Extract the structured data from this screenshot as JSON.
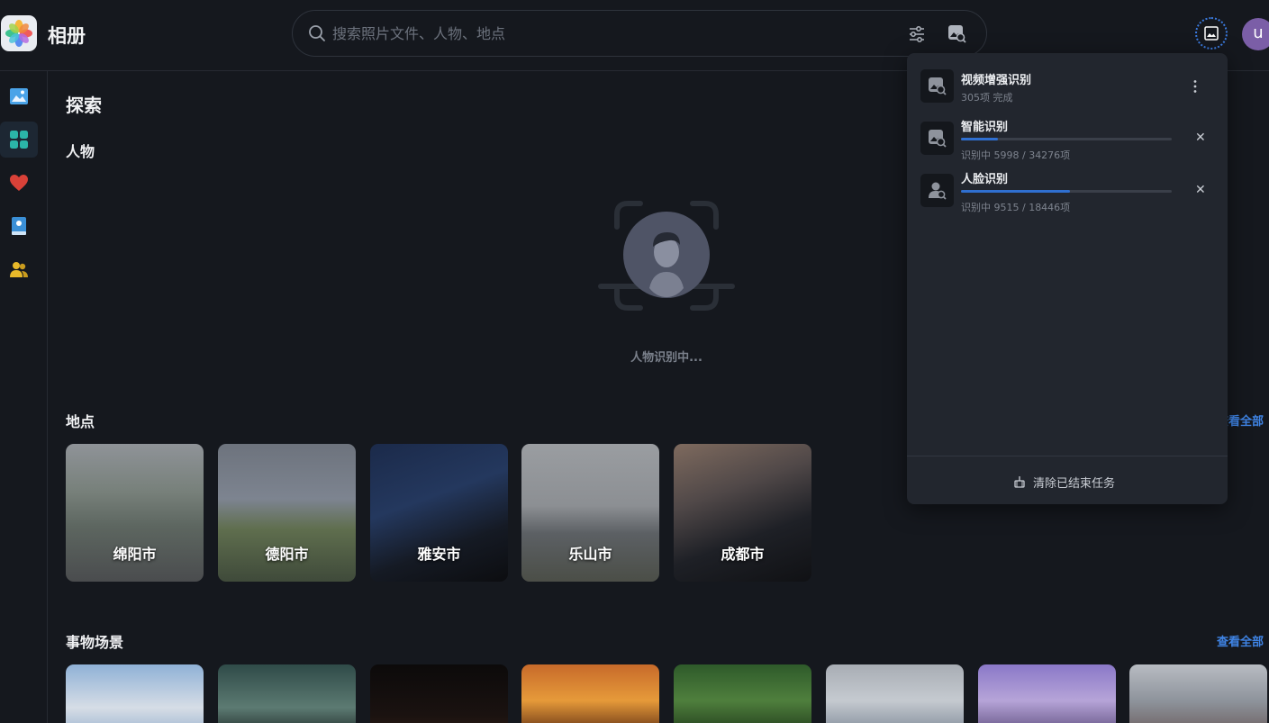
{
  "app": {
    "title": "相册"
  },
  "search": {
    "placeholder": "搜索照片文件、人物、地点"
  },
  "avatar": {
    "initial": "u"
  },
  "page": {
    "title": "探索"
  },
  "people": {
    "heading": "人物",
    "status": "人物识别中..."
  },
  "places": {
    "heading": "地点",
    "see_all": "查看全部",
    "items": [
      {
        "label": "绵阳市"
      },
      {
        "label": "德阳市"
      },
      {
        "label": "雅安市"
      },
      {
        "label": "乐山市"
      },
      {
        "label": "成都市"
      }
    ]
  },
  "scenes": {
    "heading": "事物场景",
    "see_all": "查看全部"
  },
  "tasks": {
    "items": [
      {
        "name": "视频增强识别",
        "sub": "305项 完成"
      },
      {
        "name": "智能识别",
        "sub": "识别中 5998 / 34276项",
        "progress": 0.175
      },
      {
        "name": "人脸识别",
        "sub": "识别中 9515 / 18446项",
        "progress": 0.516
      }
    ],
    "clear_label": "清除已结束任务"
  },
  "colors": {
    "accent": "#3f84e5",
    "progress": "#2f6fd0",
    "panel": "#22262e",
    "background": "#15181e"
  }
}
